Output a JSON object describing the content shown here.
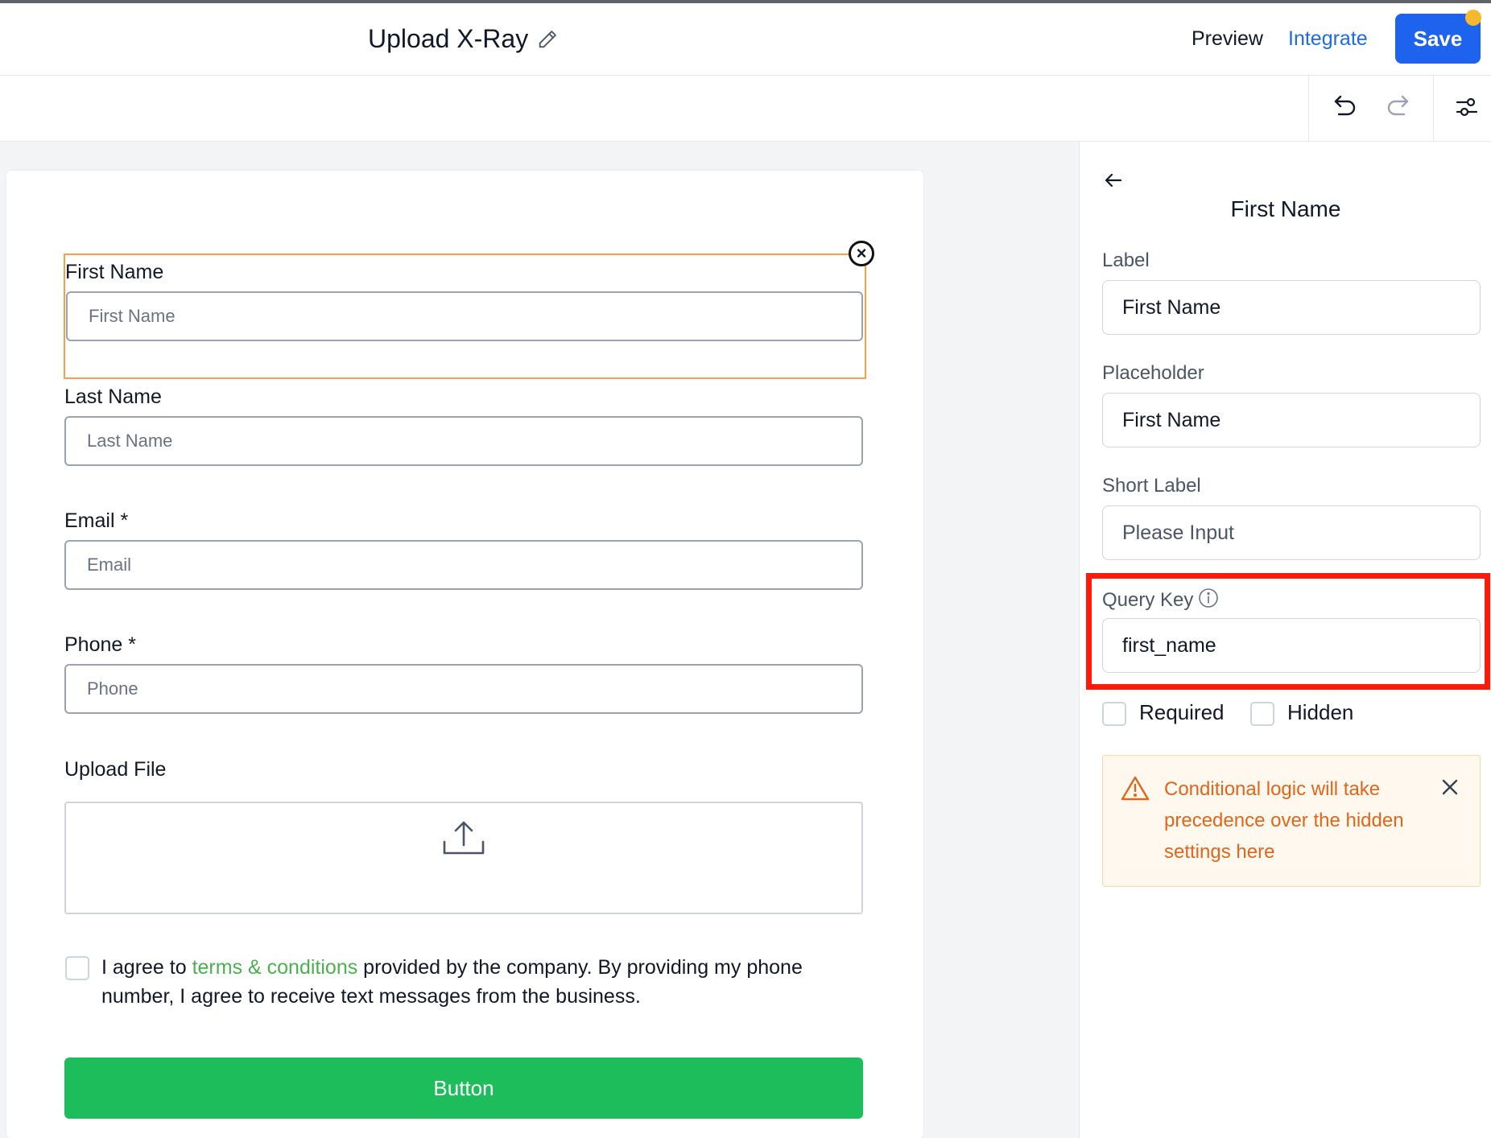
{
  "header": {
    "title": "Upload X-Ray",
    "preview_label": "Preview",
    "integrate_label": "Integrate",
    "save_label": "Save"
  },
  "toolbar": {
    "icons": [
      "undo-icon",
      "redo-icon",
      "settings-icon"
    ]
  },
  "form": {
    "fields": [
      {
        "label": "First Name",
        "placeholder": "First Name"
      },
      {
        "label": "Last Name",
        "placeholder": "Last Name"
      },
      {
        "label": "Email *",
        "placeholder": "Email"
      },
      {
        "label": "Phone *",
        "placeholder": "Phone"
      }
    ],
    "upload_label": "Upload File",
    "agree_prefix": "I agree to ",
    "agree_link": "terms & conditions",
    "agree_suffix": " provided by the company. By providing my phone number, I agree to receive text messages from the business.",
    "button_label": "Button"
  },
  "panel": {
    "title": "First Name",
    "label_heading": "Label",
    "label_value": "First Name",
    "placeholder_heading": "Placeholder",
    "placeholder_value": "First Name",
    "short_label_heading": "Short Label",
    "short_label_placeholder": "Please Input",
    "query_key_heading": "Query Key",
    "query_key_value": "first_name",
    "required_label": "Required",
    "hidden_label": "Hidden",
    "warning_text": "Conditional logic will take precedence over the hidden settings here"
  },
  "colors": {
    "accent": "#1e63ee",
    "integrate": "#1e6ae6",
    "form_button": "#1dbd5c",
    "link": "#4caf50",
    "selection_border": "#f5a04a",
    "highlight": "#ff1a0a",
    "warning_text": "#e0661c",
    "warning_bg": "#fff8ee"
  }
}
